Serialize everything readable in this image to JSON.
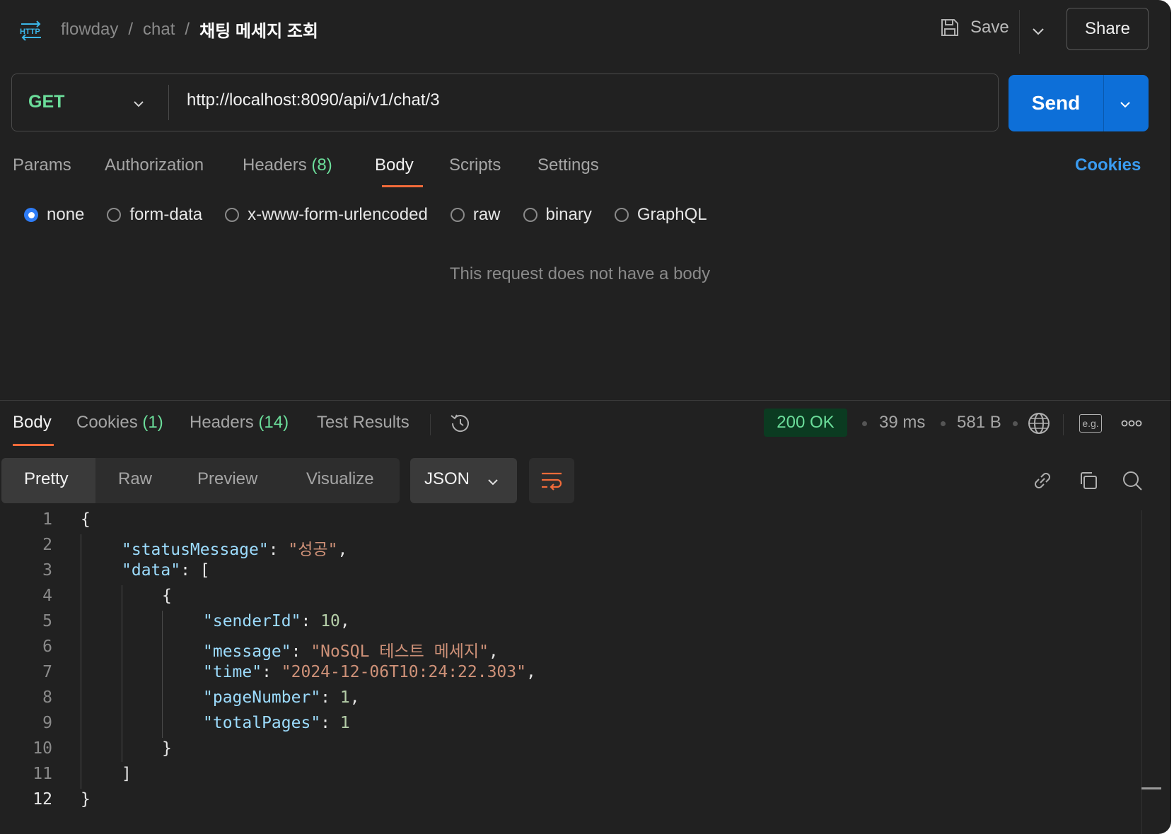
{
  "header": {
    "breadcrumb": [
      "flowday",
      "chat",
      "채팅 메세지 조회"
    ],
    "save_label": "Save",
    "share_label": "Share"
  },
  "request": {
    "method": "GET",
    "url": "http://localhost:8090/api/v1/chat/3",
    "send_label": "Send",
    "tabs": [
      {
        "label": "Params",
        "count": ""
      },
      {
        "label": "Authorization",
        "count": ""
      },
      {
        "label": "Headers",
        "count": "(8)"
      },
      {
        "label": "Body",
        "count": "",
        "active": true
      },
      {
        "label": "Scripts",
        "count": ""
      },
      {
        "label": "Settings",
        "count": ""
      }
    ],
    "cookies_label": "Cookies",
    "body_types": [
      "none",
      "form-data",
      "x-www-form-urlencoded",
      "raw",
      "binary",
      "GraphQL"
    ],
    "body_type_selected": "none",
    "empty_body_message": "This request does not have a body"
  },
  "response": {
    "tabs": [
      {
        "label": "Body",
        "count": "",
        "active": true
      },
      {
        "label": "Cookies",
        "count": "(1)"
      },
      {
        "label": "Headers",
        "count": "(14)"
      },
      {
        "label": "Test Results",
        "count": ""
      }
    ],
    "status": "200 OK",
    "time": "39 ms",
    "size": "581 B",
    "eg_label": "e.g.",
    "view_modes": [
      "Pretty",
      "Raw",
      "Preview",
      "Visualize"
    ],
    "view_mode_selected": "Pretty",
    "format": "JSON",
    "code_lines": [
      "1",
      "2",
      "3",
      "4",
      "5",
      "6",
      "7",
      "8",
      "9",
      "10",
      "11",
      "12"
    ],
    "json": {
      "statusMessage_key": "\"statusMessage\"",
      "statusMessage_val": "\"성공\"",
      "data_key": "\"data\"",
      "senderId_key": "\"senderId\"",
      "senderId_val": "10",
      "message_key": "\"message\"",
      "message_val": "\"NoSQL 테스트 메세지\"",
      "time_key": "\"time\"",
      "time_val": "\"2024-12-06T10:24:22.303\"",
      "pageNumber_key": "\"pageNumber\"",
      "pageNumber_val": "1",
      "totalPages_key": "\"totalPages\"",
      "totalPages_val": "1"
    }
  },
  "colors": {
    "accent_orange": "#f26b3a",
    "send_blue": "#0d6fd8",
    "status_green": "#6bdd9a",
    "cookies_blue": "#3a9bf0"
  }
}
